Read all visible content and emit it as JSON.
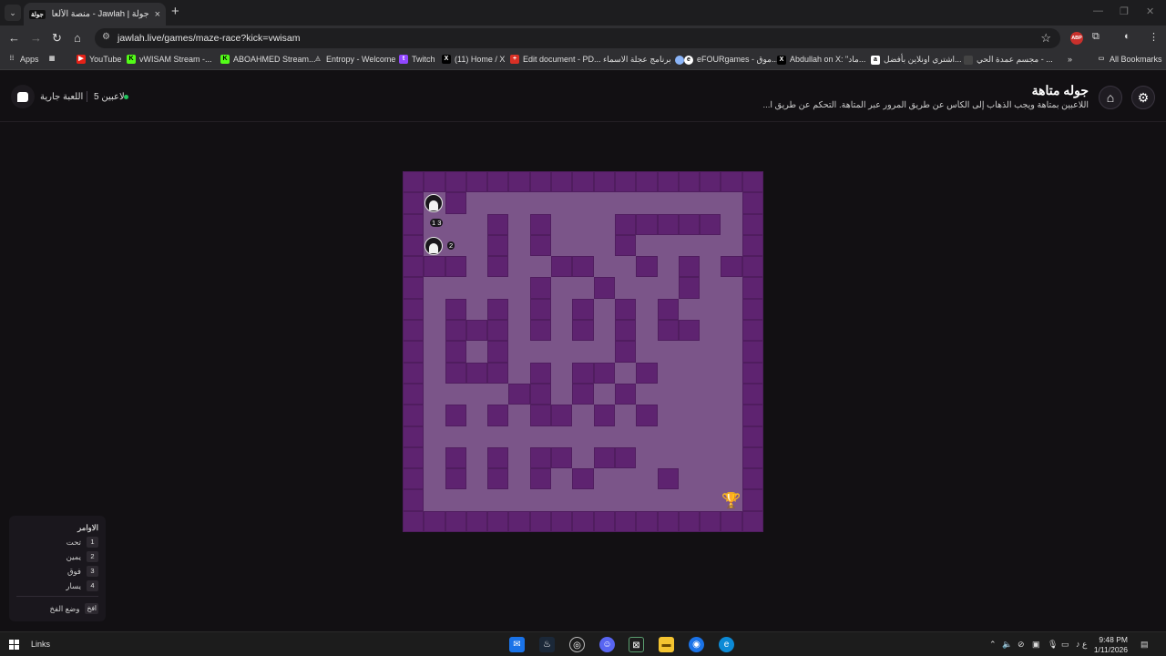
{
  "browser": {
    "tab_title": "جولة | Jawlah - منصة الألعاب الـ...",
    "tab_favicon": "جولة",
    "url": "jawlah.live/games/maze-race?kick=vwisam",
    "new_tab": "+",
    "abp_label": "ABP"
  },
  "bookmarks": {
    "apps": "Apps",
    "items": [
      "YouTube",
      "vWISAM Stream -...",
      "ABOAHMED Stream...",
      "Entropy - Welcome",
      "Twitch",
      "(11) Home / X",
      "Edit document - PD...",
      "برنامج عجلة الاسماء",
      "eFOURgames - موق...",
      "Abdullah on X: \"ماد...",
      "اشتري اونلاين بأفضل...",
      "مجسم عمدة الحي - ..."
    ],
    "all_bookmarks": "All Bookmarks"
  },
  "header": {
    "status": "اللعبة جارية",
    "players": "5 لاعبين",
    "title": "جوله متاهة",
    "description": "اللاعبين بمتاهة ويجب الذهاب إلى الكأس عن طريق المرور عبر المتاهة. التحكم عن طريق ا..."
  },
  "maze": {
    "grid": [
      "WWWWWWWWWWWWWWWWW",
      "WPWPPPPPPPPPPPPPW",
      "WPPPWPWPPPWWWWWPW",
      "WPPPWPWPPPWPPPPPW",
      "WWWPWPPWWPPWPWPWW",
      "WPPPPPWPPWPPPWPPW",
      "WPWPWPWPWPWPWPPPW",
      "WPWWWPWPWPWPWWPPW",
      "WPWPWPPPPPWPPPPPW",
      "WPWWWPWPWWPWPPPPW",
      "WPPPPWWPWPWPPPPPW",
      "WPWPWPWWPWPWPPPPW",
      "WPPPPPPPPPPPPPPPW",
      "WPWPWPWWPWWPPPPPW",
      "WPWPWPWPWPPPWPPPW",
      "WPPPPPPPPPPPPPPPW",
      "WWWWWWWWWWWWWWWWW"
    ],
    "players": [
      {
        "badge": "",
        "icon": "player-avatar-icon"
      },
      {
        "badge": "1 3",
        "icon": "player-badge"
      },
      {
        "badge": "2",
        "icon": "player-avatar-icon"
      }
    ],
    "goal_icon": "trophy-icon"
  },
  "commands": {
    "title": "الاوامر",
    "items": [
      {
        "key": "1",
        "label": "تحت"
      },
      {
        "key": "2",
        "label": "يمين"
      },
      {
        "key": "3",
        "label": "فوق"
      },
      {
        "key": "4",
        "label": "يسار"
      }
    ],
    "fog_key": "افخ",
    "fog_label": "وضع الفخ"
  },
  "taskbar": {
    "links": "Links",
    "lang": "ع",
    "time": "9:48 PM",
    "date": "1/11/2026"
  }
}
